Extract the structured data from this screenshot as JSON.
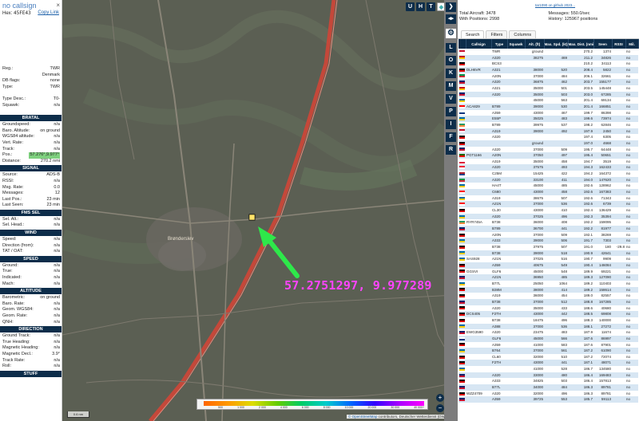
{
  "sidebar": {
    "callsign": "no callsign",
    "hex_label": "Hex:",
    "hex": "45FE43",
    "copy_link": "Copy Link",
    "close": "×",
    "top_rows": [
      [
        "Reg.:",
        "TWR"
      ],
      [
        "",
        "Denmark"
      ],
      [
        "DB flags:",
        "none"
      ],
      [
        "Type:",
        "TWR"
      ],
      [
        "",
        ""
      ],
      [
        "Type Desc.:",
        "T0-"
      ],
      [
        "Squawk:",
        "n/a"
      ]
    ],
    "s_baltal": "BRATAL",
    "baltal_rows": [
      [
        "Groundspeed:",
        "n/a"
      ],
      [
        "Baro. Altitude:",
        "on ground"
      ],
      [
        "WGS84 altitude:",
        "n/a"
      ],
      [
        "Vert. Rate:",
        "n/a"
      ],
      [
        "Track:",
        "n/a"
      ],
      [
        "Pos.:",
        "57.276°,9.977°"
      ],
      [
        "Distance:",
        "270.2 nmi"
      ]
    ],
    "s_signal": "SIGNAL",
    "signal_rows": [
      [
        "Source:",
        "ADS-B"
      ],
      [
        "RSSI:",
        "n/a"
      ],
      [
        "Msg. Rate:",
        "0.0"
      ],
      [
        "Messages:",
        "12"
      ],
      [
        "Last Pos.:",
        "23 min"
      ],
      [
        "Last Seen:",
        "23 min"
      ]
    ],
    "s_fms": "FMS SEL",
    "fms_rows": [
      [
        "Sel. Alt.:",
        "n/a"
      ],
      [
        "Sel. Head.:",
        "n/a"
      ]
    ],
    "s_wind": "WIND",
    "wind_rows": [
      [
        "Speed:",
        "n/a"
      ],
      [
        "Direction (from):",
        "n/a"
      ],
      [
        "TAT / OAT:",
        "n/a"
      ]
    ],
    "s_speed": "SPEED",
    "speed_rows": [
      [
        "Ground:",
        "n/a"
      ],
      [
        "True:",
        "n/a"
      ],
      [
        "Indicated:",
        "n/a"
      ],
      [
        "Mach:",
        "n/a"
      ]
    ],
    "s_alt": "ALTITUDE",
    "alt_rows": [
      [
        "Barometric:",
        "on ground"
      ],
      [
        "Baro. Rate:",
        "n/a"
      ],
      [
        "Geom. WGS84:",
        "n/a"
      ],
      [
        "Geom. Rate:",
        "n/a"
      ],
      [
        "QNH:",
        "n/a"
      ]
    ],
    "s_dir": "DIRECTION",
    "dir_rows": [
      [
        "Ground Track:",
        "n/a"
      ],
      [
        "True Heading:",
        "n/a"
      ],
      [
        "Magnetic Heading:",
        "n/a"
      ],
      [
        "Magnetic Decl.:",
        "3.9°"
      ],
      [
        "Track Rate:",
        "n/a"
      ],
      [
        "Roll:",
        "n/a"
      ]
    ],
    "s_stuff": "STUFF"
  },
  "map": {
    "buttons": [
      "U",
      "H",
      "T"
    ],
    "town_label": "Brønderslev",
    "coord_overlay": "57.2751297, 9.977289",
    "scale": "0.6 nm",
    "legend_ticks": [
      "",
      "500",
      "1 000",
      "2 000",
      "4 000",
      "6 000",
      "8 000",
      "10 000",
      "20 000",
      "30 000",
      "40 000+"
    ],
    "attrib_osm": "© OpenStreetMap",
    "attrib_rest": " contributors, Deutscher Wetterdienst (DWD)",
    "zoom_in": "+",
    "zoom_out": "−",
    "colors": {
      "arrow": "#2ee84a",
      "overlay": "#ff44ff",
      "road": "#d64a3a"
    }
  },
  "strip": {
    "buttons": [
      "L",
      "O",
      "K",
      "M",
      "V",
      "P",
      "I",
      "F",
      "R"
    ]
  },
  "panel": {
    "applink": "tar1090 on github 2023...",
    "stats": [
      [
        "Total Aircraft:",
        "3478"
      ],
      [
        "Messages:",
        "550.0/sec"
      ],
      [
        "With Positions:",
        "2998"
      ],
      [
        "History:",
        "125967 positions"
      ]
    ],
    "tabs": [
      "Search",
      "Filters",
      "Columns"
    ],
    "headers": [
      "",
      "Callsign",
      "Type",
      "Squawk",
      "Alt. (ft)",
      "Max. Spd. (kt)",
      "Max. Dist. (nmi)",
      "Seen",
      "RSSI",
      "Mil."
    ],
    "rows": [
      [
        "dk",
        "",
        "TWR",
        "",
        "ground",
        "",
        "270.2",
        "1374",
        "",
        "no"
      ],
      [
        "es",
        "",
        "A320",
        "",
        "38275",
        "469",
        "211.2",
        "34826",
        "",
        "no"
      ],
      [
        "de",
        "",
        "BCS3",
        "",
        "",
        "",
        "210.2",
        "34113",
        "",
        "no"
      ],
      [
        "de",
        "DLH6VR",
        "A321",
        "",
        "38000",
        "520",
        "208.4",
        "5822",
        "",
        "no"
      ],
      [
        "it",
        "",
        "A20N",
        "",
        "37000",
        "484",
        "206.1",
        "32661",
        "",
        "no"
      ],
      [
        "gb",
        "",
        "A320",
        "",
        "36875",
        "462",
        "203.7",
        "155177",
        "",
        "no"
      ],
      [
        "es",
        "",
        "A321",
        "",
        "35000",
        "501",
        "203.5",
        "145448",
        "",
        "no"
      ],
      [
        "gb",
        "",
        "A320",
        "",
        "35000",
        "503",
        "203.0",
        "67285",
        "",
        "no"
      ],
      [
        "se",
        "",
        "",
        "",
        "45000",
        "563",
        "201.4",
        "69134",
        "",
        "no"
      ],
      [
        "ca",
        "ACA829",
        "B789",
        "",
        "39000",
        "530",
        "201.4",
        "166851",
        "",
        "no"
      ],
      [
        "fi",
        "",
        "A359",
        "",
        "43000",
        "467",
        "199.7",
        "86398",
        "",
        "no"
      ],
      [
        "se",
        "",
        "E55P",
        "",
        "35025",
        "483",
        "199.6",
        "73974",
        "",
        "no"
      ],
      [
        "ie",
        "",
        "B789",
        "",
        "39975",
        "537",
        "198.2",
        "62846",
        "",
        "no"
      ],
      [
        "dk",
        "",
        "A319",
        "",
        "39000",
        "492",
        "197.9",
        "2450",
        "",
        "no"
      ],
      [
        "de",
        "",
        "A320",
        "",
        "",
        "",
        "197.4",
        "6305",
        "",
        "no"
      ],
      [
        "de",
        "",
        "",
        "",
        "ground",
        "",
        "197.0",
        "4668",
        "",
        "no"
      ],
      [
        "gb",
        "",
        "A320",
        "",
        "37000",
        "509",
        "195.7",
        "64448",
        "",
        "no"
      ],
      [
        "pt",
        "PGT1166",
        "A20N",
        "",
        "37050",
        "497",
        "195.4",
        "50651",
        "",
        "no"
      ],
      [
        "pl",
        "",
        "A319",
        "",
        "35000",
        "458",
        "194.7",
        "3519",
        "",
        "no"
      ],
      [
        "at",
        "",
        "A320",
        "",
        "37575",
        "493",
        "194.3",
        "162433",
        "",
        "no"
      ],
      [
        "nl",
        "",
        "C25M",
        "",
        "15425",
        "422",
        "194.2",
        "164372",
        "",
        "no"
      ],
      [
        "it",
        "",
        "A320",
        "",
        "33100",
        "411",
        "194.0",
        "147620",
        "",
        "no"
      ],
      [
        "se",
        "",
        "HA4T",
        "",
        "45000",
        "485",
        "192.6",
        "128962",
        "",
        "no"
      ],
      [
        "ch",
        "",
        "C680",
        "",
        "43000",
        "458",
        "192.6",
        "167383",
        "",
        "no"
      ],
      [
        "se",
        "",
        "A319",
        "",
        "38675",
        "507",
        "192.6",
        "71343",
        "",
        "no"
      ],
      [
        "ch",
        "",
        "A21N",
        "",
        "37000",
        "536",
        "192.6",
        "6739",
        "",
        "no"
      ],
      [
        "de",
        "",
        "CL30",
        "",
        "43000",
        "410",
        "192.4",
        "136429",
        "",
        "no"
      ],
      [
        "se",
        "",
        "A320",
        "",
        "37025",
        "496",
        "192.3",
        "35394",
        "",
        "no"
      ],
      [
        "ie",
        "RYR745A",
        "B738",
        "",
        "36000",
        "408",
        "192.2",
        "159095",
        "",
        "no"
      ],
      [
        "gb",
        "",
        "B789",
        "",
        "36700",
        "441",
        "192.2",
        "81977",
        "",
        "no"
      ],
      [
        "de",
        "",
        "A20N",
        "",
        "37000",
        "509",
        "192.1",
        "38269",
        "",
        "no"
      ],
      [
        "se",
        "",
        "A333",
        "",
        "39000",
        "506",
        "191.7",
        "7303",
        "",
        "no"
      ],
      [
        "de",
        "",
        "B738",
        "",
        "37975",
        "507",
        "191.0",
        "180",
        "-29.8",
        "no"
      ],
      [
        "se",
        "",
        "B738",
        "",
        "39000",
        "518",
        "190.9",
        "42641",
        "",
        "no"
      ],
      [
        "se",
        "SAS928",
        "A21N",
        "",
        "37025",
        "516",
        "190.7",
        "9909",
        "",
        "no"
      ],
      [
        "de",
        "",
        "A359",
        "",
        "40675",
        "549",
        "190.4",
        "146084",
        "",
        "no"
      ],
      [
        "de",
        "GGSVI",
        "GLF6",
        "",
        "45000",
        "548",
        "189.9",
        "69221",
        "",
        "no"
      ],
      [
        "gb",
        "",
        "A21N",
        "",
        "36950",
        "485",
        "189.3",
        "127090",
        "",
        "no"
      ],
      [
        "se",
        "",
        "B77L",
        "",
        "25050",
        "1064",
        "189.2",
        "110403",
        "",
        "no"
      ],
      [
        "de",
        "",
        "B38M",
        "",
        "38000",
        "414",
        "189.2",
        "158614",
        "",
        "no"
      ],
      [
        "de",
        "",
        "A319",
        "",
        "36000",
        "454",
        "189.0",
        "82557",
        "",
        "no"
      ],
      [
        "gb",
        "",
        "B738",
        "",
        "37000",
        "512",
        "188.8",
        "167285",
        "",
        "no"
      ],
      [
        "de",
        "",
        "A320",
        "",
        "35000",
        "433",
        "188.6",
        "40680",
        "",
        "no"
      ],
      [
        "de",
        "DCS405",
        "F2TH",
        "",
        "43000",
        "442",
        "188.5",
        "69808",
        "",
        "no"
      ],
      [
        "de",
        "",
        "B738",
        "",
        "18475",
        "496",
        "188.3",
        "140000",
        "",
        "no"
      ],
      [
        "se",
        "",
        "A388",
        "",
        "37000",
        "536",
        "188.1",
        "27272",
        "",
        "no"
      ],
      [
        "gb",
        "EWG3590",
        "A320",
        "",
        "23475",
        "483",
        "187.9",
        "11674",
        "",
        "no"
      ],
      [
        "fi",
        "",
        "GLF6",
        "",
        "45000",
        "566",
        "187.6",
        "86997",
        "",
        "no"
      ],
      [
        "de",
        "",
        "A359",
        "",
        "41000",
        "583",
        "187.6",
        "87901",
        "",
        "no"
      ],
      [
        "se",
        "",
        "B764",
        "",
        "37000",
        "561",
        "187.2",
        "61090",
        "",
        "no"
      ],
      [
        "de",
        "",
        "CL60",
        "",
        "32000",
        "510",
        "187.2",
        "72074",
        "",
        "no"
      ],
      [
        "de",
        "",
        "F2TH",
        "",
        "43000",
        "441",
        "187.1",
        "48071",
        "",
        "no"
      ],
      [
        "se",
        "",
        "",
        "",
        "41000",
        "528",
        "186.7",
        "134580",
        "",
        "no"
      ],
      [
        "gb",
        "",
        "A320",
        "",
        "33000",
        "480",
        "186.4",
        "169483",
        "",
        "no"
      ],
      [
        "de",
        "",
        "A333",
        "",
        "34825",
        "503",
        "186.4",
        "157813",
        "",
        "no"
      ],
      [
        "gb",
        "",
        "B77L",
        "",
        "34000",
        "484",
        "186.3",
        "89781",
        "",
        "no"
      ],
      [
        "de",
        "WZZ4709",
        "A320",
        "",
        "32000",
        "496",
        "186.3",
        "89781",
        "",
        "no"
      ],
      [
        "gb",
        "",
        "A359",
        "",
        "39725",
        "553",
        "185.7",
        "59113",
        "",
        "no"
      ]
    ]
  }
}
